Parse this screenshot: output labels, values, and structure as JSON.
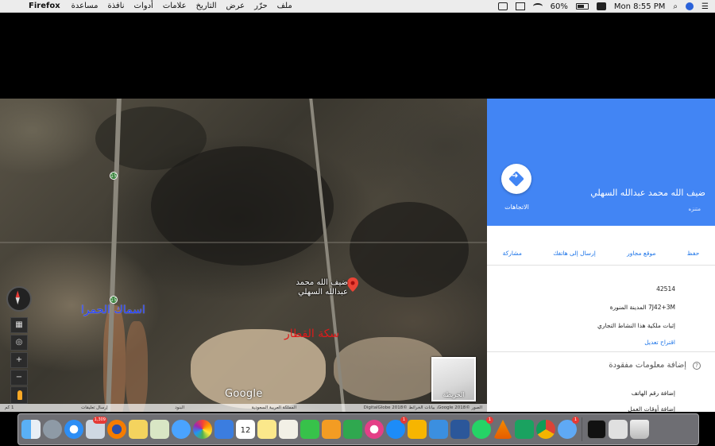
{
  "menubar": {
    "app_name": "Firefox",
    "menus": [
      "ملف",
      "حرّر",
      "عرض",
      "التاريخ",
      "علامات",
      "أدوات",
      "نافذة",
      "مساعدة"
    ],
    "battery_percent": "60%",
    "clock": "Mon 8:55 PM"
  },
  "map": {
    "pin_label": "ضيف الله محمد عبدالله السهلي",
    "handwritten_blue": "اسماك الحمرا",
    "handwritten_red": "سكة القطار",
    "road_shield_1": "15",
    "road_shield_2": "15",
    "thumb_label": "الخريطة",
    "google_logo": "Google",
    "attribution": {
      "imagery": "الصور ©2018 Google، بيانات الخرائط ©DigitalGlobe 2018",
      "country": "المملكة العربية السعودية",
      "terms": "البنود",
      "feedback": "إرسال تعليقات",
      "scale": "1 كم"
    }
  },
  "panel": {
    "directions_label": "الاتجاهات",
    "title": "ضيف الله محمد عبدالله السهلي",
    "subtitle": "متنزه",
    "actions": [
      "حفظ",
      "موقع مجاور",
      "إرسال إلى هاتفك",
      "مشاركة"
    ],
    "postal_code": "42514",
    "plus_code": "7J42+3M المدينة المنورة",
    "claim_business": "إثبات ملكية هذا النشاط التجاري",
    "suggest_edit": "اقتراح تعديل",
    "missing_info": "إضافة معلومات مفقودة",
    "add_phone": "إضافة رقم الهاتف",
    "add_hours": "إضافة أوقات العمل"
  },
  "dock": {
    "badges": {
      "mail": "1,309",
      "app_store": "1",
      "whatsapp": "1",
      "chat": "1"
    },
    "icons": [
      "finder-icon",
      "launchpad-icon",
      "safari-icon",
      "mail-icon",
      "firefox-icon",
      "notes-icon",
      "preview-icon",
      "messages-icon",
      "photos-icon",
      "keynote-icon",
      "calendar-icon",
      "stickies-icon",
      "textedit-icon",
      "facetime-icon",
      "pages-icon",
      "numbers-icon",
      "itunes-icon",
      "app-store-icon",
      "sketch-icon",
      "migration-icon",
      "word-icon",
      "whatsapp-icon",
      "vlc-icon",
      "vpn-icon",
      "chrome-icon",
      "chat-icon",
      "terminal-icon",
      "keyboard-icon",
      "trash-icon"
    ],
    "calendar_day": "12"
  },
  "colors": {
    "panel_header": "#4285f4",
    "link": "#1a73e8",
    "pin": "#ea4335"
  }
}
